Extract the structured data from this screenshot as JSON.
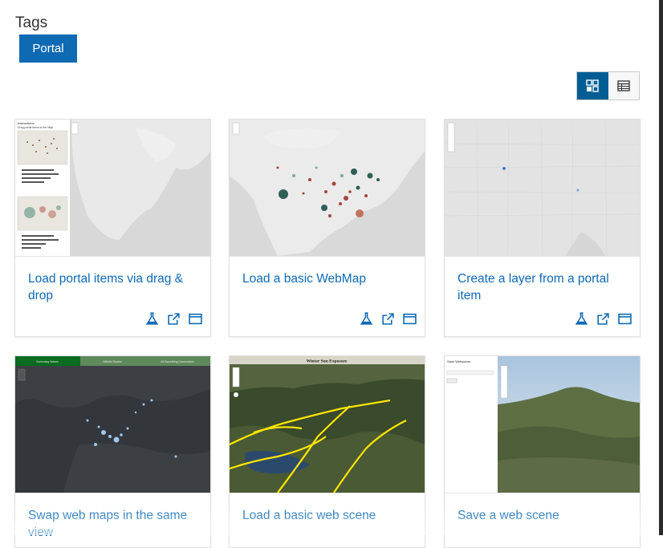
{
  "tags": {
    "title": "Tags",
    "chips": [
      "Portal"
    ]
  },
  "view_toggle": {
    "grid_icon": "grid-icon",
    "table_icon": "table-icon",
    "active": "grid"
  },
  "cards": [
    {
      "title": "Load portal items via drag & drop",
      "thumbnail_icon": "map-thumbnail"
    },
    {
      "title": "Load a basic WebMap",
      "thumbnail_icon": "map-thumbnail"
    },
    {
      "title": "Create a layer from a portal item",
      "thumbnail_icon": "map-thumbnail"
    },
    {
      "title": "Swap web maps in the same view",
      "thumbnail_icon": "map-thumbnail"
    },
    {
      "title": "Load a basic web scene",
      "thumbnail_icon": "scene-thumbnail"
    },
    {
      "title": "Save a web scene",
      "thumbnail_icon": "scene-thumbnail"
    }
  ],
  "thumbnails": {
    "drag_drop": {
      "instructions": "Instructions:",
      "instructions_sub": "Drag portal items to the Map"
    },
    "swap": {
      "tabs": [
        "Swimming Waves",
        "Wildlife Routes",
        "All Something Connections"
      ]
    },
    "scene": {
      "title": "Winter Sun Exposure"
    },
    "save_scene": {
      "title": "Save Webscene"
    }
  },
  "card_actions": [
    "flask-icon",
    "share-icon",
    "window-icon"
  ],
  "colors": {
    "accent": "#0f6ab4",
    "toggle_active": "#005e95"
  }
}
